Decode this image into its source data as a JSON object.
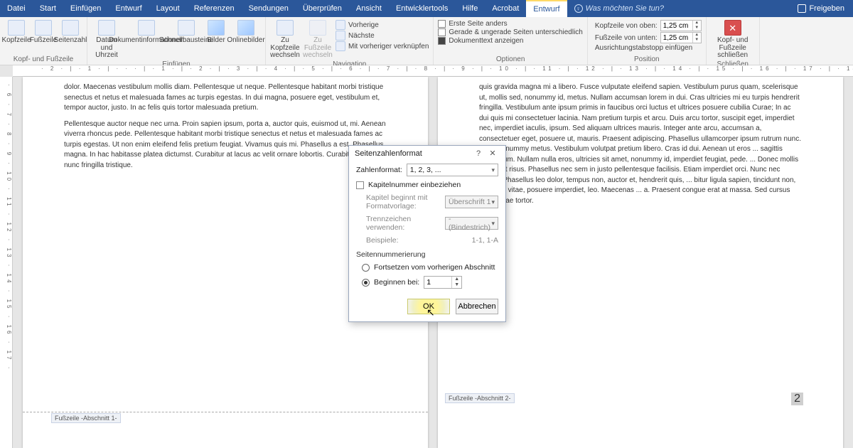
{
  "tabs": {
    "file": "Datei",
    "start": "Start",
    "insert": "Einfügen",
    "design": "Entwurf",
    "layout": "Layout",
    "references": "Referenzen",
    "mailings": "Sendungen",
    "review": "Überprüfen",
    "view": "Ansicht",
    "devtools": "Entwicklertools",
    "help": "Hilfe",
    "acrobat": "Acrobat",
    "context": "Entwurf",
    "tell_me": "Was möchten Sie tun?",
    "share": "Freigeben"
  },
  "ribbon": {
    "hf_group": "Kopf- und Fußzeile",
    "hf_header": "Kopfzeile",
    "hf_footer": "Fußzeile",
    "hf_pagenum": "Seitenzahl",
    "insert_group": "Einfügen",
    "ins_datetime": "Datum und Uhrzeit",
    "ins_docinfo": "Dokumentinformationen",
    "ins_quick": "Schnellbausteine",
    "ins_pic": "Bilder",
    "ins_online": "Onlinebilder",
    "nav_group": "Navigation",
    "nav_gotohdr": "Zu Kopfzeile wechseln",
    "nav_gotoftr": "Zu Fußzeile wechseln",
    "nav_prev": "Vorherige",
    "nav_next": "Nächste",
    "nav_link": "Mit vorheriger verknüpfen",
    "opt_group": "Optionen",
    "opt_first": "Erste Seite anders",
    "opt_oddeven": "Gerade & ungerade Seiten unterschiedlich",
    "opt_doctext": "Dokumenttext anzeigen",
    "pos_group": "Position",
    "pos_top": "Kopfzeile von oben:",
    "pos_bottom": "Fußzeile von unten:",
    "pos_val": "1,25 cm",
    "pos_align": "Ausrichtungstabstopp einfügen",
    "close_group": "Schließen",
    "close_btn": "Kopf- und Fußzeile schließen"
  },
  "ruler_h": "· 2 · | · 1 · | · · · | · 1 · | · 2 · | · 3 · | · 4 · | · 5 · | · 6 · | · 7 · | · 8 · | · 9 · | · 10 · | · 11 · | · 12 · | · 13 · | · 14 · | · 15 · | · 16 · | · 17 · | · 18 ·",
  "ruler_v": "· 6 · 7 · 8 · 9 · 10 · 11 · 12 · 13 · 14 · 15 · 16 · 17 ·",
  "page1": {
    "p1": "dolor. Maecenas vestibulum mollis diam. Pellentesque ut neque. Pellentesque habitant morbi tristique senectus et netus et malesuada fames ac turpis egestas. In dui magna, posuere eget, vestibulum et, tempor auctor, justo. In ac felis quis tortor malesuada pretium.",
    "p2": "Pellentesque auctor neque nec urna. Proin sapien ipsum, porta a, auctor quis, euismod ut, mi. Aenean viverra rhoncus pede. Pellentesque habitant morbi tristique senectus et netus et malesuada fames ac turpis egestas. Ut non enim eleifend felis pretium feugiat. Vivamus quis mi. Phasellus a est. Phasellus magna. In hac habitasse platea dictumst. Curabitur at lacus ac velit ornare lobortis. Curabitur a felis in nunc fringilla tristique.",
    "footer_label": "Fußzeile -Abschnitt 1-"
  },
  "page2": {
    "p1": "quis gravida magna mi a libero. Fusce vulputate eleifend sapien. Vestibulum purus quam, scelerisque ut, mollis sed, nonummy id, metus. Nullam accumsan lorem in dui. Cras ultricies mi eu turpis hendrerit fringilla. Vestibulum ante ipsum primis in faucibus orci luctus et ultrices posuere cubilia Curae; In ac dui quis mi consectetuer lacinia. Nam pretium turpis et arcu. Duis arcu tortor, suscipit eget, imperdiet nec, imperdiet iaculis, ipsum. Sed aliquam ultrices mauris. Integer ante arcu, accumsan a, consectetuer eget, posuere ut, mauris. Praesent adipiscing. Phasellus ullamcorper ipsum rutrum nunc. Nunc nonummy metus. Vestibulum volutpat pretium libero. Cras id dui. Aenean ut eros ... sagittis vestibulum. Nullam nulla eros, ultricies sit amet, nonummy id, imperdiet feugiat, pede. ... Donec mollis hendrerit risus. Phasellus nec sem in justo pellentesque facilisis. Etiam imperdiet orci. Nunc nec neque. Phasellus leo dolor, tempus non, auctor et, hendrerit quis, ... bitur ligula sapien, tincidunt non, euismod vitae, posuere imperdiet, leo. Maecenas ... a. Praesent congue erat at massa. Sed cursus turpis vitae tortor.",
    "footer_label": "Fußzeile -Abschnitt 2-",
    "page_number": "2"
  },
  "dialog": {
    "title": "Seitenzahlenformat",
    "help": "?",
    "close": "✕",
    "format_label": "Zahlenformat:",
    "format_value": "1, 2, 3, ...",
    "include_chapter": "Kapitelnummer einbeziehen",
    "chapter_style_label": "Kapitel beginnt mit Formatvorlage:",
    "chapter_style_value": "Überschrift 1",
    "separator_label": "Trennzeichen verwenden:",
    "separator_value": "-   (Bindestrich)",
    "examples_label": "Beispiele:",
    "examples_value": "1-1, 1-A",
    "numbering_label": "Seitennummerierung",
    "continue_label": "Fortsetzen vom vorherigen Abschnitt",
    "startat_label": "Beginnen bei:",
    "startat_value": "1",
    "ok": "OK",
    "cancel": "Abbrechen"
  }
}
